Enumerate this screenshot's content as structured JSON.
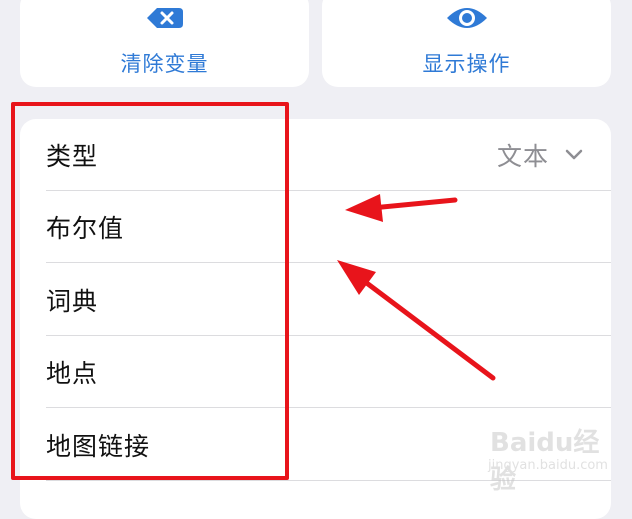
{
  "actions": {
    "clear": {
      "label": "清除变量",
      "icon": "clear-icon"
    },
    "show": {
      "label": "显示操作",
      "icon": "eye-icon"
    }
  },
  "type_row": {
    "label": "类型",
    "value": "文本",
    "icon": "chevron-down-icon"
  },
  "options": [
    {
      "label": "布尔值"
    },
    {
      "label": "词典"
    },
    {
      "label": "地点"
    },
    {
      "label": "地图链接"
    }
  ],
  "annotations": {
    "highlight_color": "#e8141b"
  },
  "watermark": {
    "text": "Baidu经验",
    "url": "jingyan.baidu.com"
  },
  "colors": {
    "accent": "#2f7ad6",
    "background": "#efeff4",
    "secondary_text": "#8e8e93"
  }
}
